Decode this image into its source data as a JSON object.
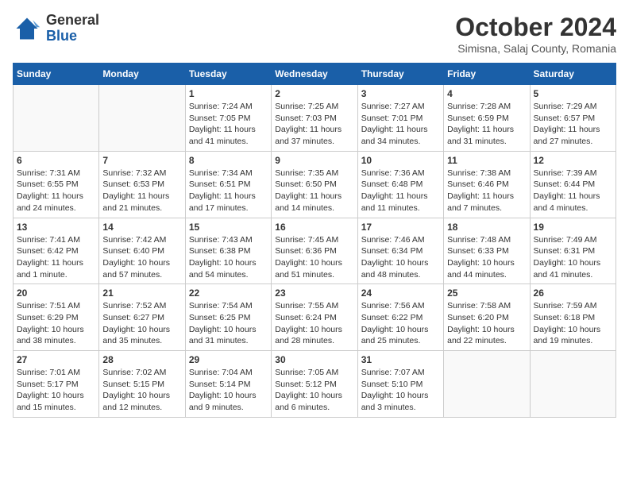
{
  "logo": {
    "line1": "General",
    "line2": "Blue"
  },
  "title": "October 2024",
  "location": "Simisna, Salaj County, Romania",
  "days_of_week": [
    "Sunday",
    "Monday",
    "Tuesday",
    "Wednesday",
    "Thursday",
    "Friday",
    "Saturday"
  ],
  "weeks": [
    [
      {
        "day": "",
        "info": ""
      },
      {
        "day": "",
        "info": ""
      },
      {
        "day": "1",
        "sunrise": "Sunrise: 7:24 AM",
        "sunset": "Sunset: 7:05 PM",
        "daylight": "Daylight: 11 hours and 41 minutes."
      },
      {
        "day": "2",
        "sunrise": "Sunrise: 7:25 AM",
        "sunset": "Sunset: 7:03 PM",
        "daylight": "Daylight: 11 hours and 37 minutes."
      },
      {
        "day": "3",
        "sunrise": "Sunrise: 7:27 AM",
        "sunset": "Sunset: 7:01 PM",
        "daylight": "Daylight: 11 hours and 34 minutes."
      },
      {
        "day": "4",
        "sunrise": "Sunrise: 7:28 AM",
        "sunset": "Sunset: 6:59 PM",
        "daylight": "Daylight: 11 hours and 31 minutes."
      },
      {
        "day": "5",
        "sunrise": "Sunrise: 7:29 AM",
        "sunset": "Sunset: 6:57 PM",
        "daylight": "Daylight: 11 hours and 27 minutes."
      }
    ],
    [
      {
        "day": "6",
        "sunrise": "Sunrise: 7:31 AM",
        "sunset": "Sunset: 6:55 PM",
        "daylight": "Daylight: 11 hours and 24 minutes."
      },
      {
        "day": "7",
        "sunrise": "Sunrise: 7:32 AM",
        "sunset": "Sunset: 6:53 PM",
        "daylight": "Daylight: 11 hours and 21 minutes."
      },
      {
        "day": "8",
        "sunrise": "Sunrise: 7:34 AM",
        "sunset": "Sunset: 6:51 PM",
        "daylight": "Daylight: 11 hours and 17 minutes."
      },
      {
        "day": "9",
        "sunrise": "Sunrise: 7:35 AM",
        "sunset": "Sunset: 6:50 PM",
        "daylight": "Daylight: 11 hours and 14 minutes."
      },
      {
        "day": "10",
        "sunrise": "Sunrise: 7:36 AM",
        "sunset": "Sunset: 6:48 PM",
        "daylight": "Daylight: 11 hours and 11 minutes."
      },
      {
        "day": "11",
        "sunrise": "Sunrise: 7:38 AM",
        "sunset": "Sunset: 6:46 PM",
        "daylight": "Daylight: 11 hours and 7 minutes."
      },
      {
        "day": "12",
        "sunrise": "Sunrise: 7:39 AM",
        "sunset": "Sunset: 6:44 PM",
        "daylight": "Daylight: 11 hours and 4 minutes."
      }
    ],
    [
      {
        "day": "13",
        "sunrise": "Sunrise: 7:41 AM",
        "sunset": "Sunset: 6:42 PM",
        "daylight": "Daylight: 11 hours and 1 minute."
      },
      {
        "day": "14",
        "sunrise": "Sunrise: 7:42 AM",
        "sunset": "Sunset: 6:40 PM",
        "daylight": "Daylight: 10 hours and 57 minutes."
      },
      {
        "day": "15",
        "sunrise": "Sunrise: 7:43 AM",
        "sunset": "Sunset: 6:38 PM",
        "daylight": "Daylight: 10 hours and 54 minutes."
      },
      {
        "day": "16",
        "sunrise": "Sunrise: 7:45 AM",
        "sunset": "Sunset: 6:36 PM",
        "daylight": "Daylight: 10 hours and 51 minutes."
      },
      {
        "day": "17",
        "sunrise": "Sunrise: 7:46 AM",
        "sunset": "Sunset: 6:34 PM",
        "daylight": "Daylight: 10 hours and 48 minutes."
      },
      {
        "day": "18",
        "sunrise": "Sunrise: 7:48 AM",
        "sunset": "Sunset: 6:33 PM",
        "daylight": "Daylight: 10 hours and 44 minutes."
      },
      {
        "day": "19",
        "sunrise": "Sunrise: 7:49 AM",
        "sunset": "Sunset: 6:31 PM",
        "daylight": "Daylight: 10 hours and 41 minutes."
      }
    ],
    [
      {
        "day": "20",
        "sunrise": "Sunrise: 7:51 AM",
        "sunset": "Sunset: 6:29 PM",
        "daylight": "Daylight: 10 hours and 38 minutes."
      },
      {
        "day": "21",
        "sunrise": "Sunrise: 7:52 AM",
        "sunset": "Sunset: 6:27 PM",
        "daylight": "Daylight: 10 hours and 35 minutes."
      },
      {
        "day": "22",
        "sunrise": "Sunrise: 7:54 AM",
        "sunset": "Sunset: 6:25 PM",
        "daylight": "Daylight: 10 hours and 31 minutes."
      },
      {
        "day": "23",
        "sunrise": "Sunrise: 7:55 AM",
        "sunset": "Sunset: 6:24 PM",
        "daylight": "Daylight: 10 hours and 28 minutes."
      },
      {
        "day": "24",
        "sunrise": "Sunrise: 7:56 AM",
        "sunset": "Sunset: 6:22 PM",
        "daylight": "Daylight: 10 hours and 25 minutes."
      },
      {
        "day": "25",
        "sunrise": "Sunrise: 7:58 AM",
        "sunset": "Sunset: 6:20 PM",
        "daylight": "Daylight: 10 hours and 22 minutes."
      },
      {
        "day": "26",
        "sunrise": "Sunrise: 7:59 AM",
        "sunset": "Sunset: 6:18 PM",
        "daylight": "Daylight: 10 hours and 19 minutes."
      }
    ],
    [
      {
        "day": "27",
        "sunrise": "Sunrise: 7:01 AM",
        "sunset": "Sunset: 5:17 PM",
        "daylight": "Daylight: 10 hours and 15 minutes."
      },
      {
        "day": "28",
        "sunrise": "Sunrise: 7:02 AM",
        "sunset": "Sunset: 5:15 PM",
        "daylight": "Daylight: 10 hours and 12 minutes."
      },
      {
        "day": "29",
        "sunrise": "Sunrise: 7:04 AM",
        "sunset": "Sunset: 5:14 PM",
        "daylight": "Daylight: 10 hours and 9 minutes."
      },
      {
        "day": "30",
        "sunrise": "Sunrise: 7:05 AM",
        "sunset": "Sunset: 5:12 PM",
        "daylight": "Daylight: 10 hours and 6 minutes."
      },
      {
        "day": "31",
        "sunrise": "Sunrise: 7:07 AM",
        "sunset": "Sunset: 5:10 PM",
        "daylight": "Daylight: 10 hours and 3 minutes."
      },
      {
        "day": "",
        "info": ""
      },
      {
        "day": "",
        "info": ""
      }
    ]
  ]
}
